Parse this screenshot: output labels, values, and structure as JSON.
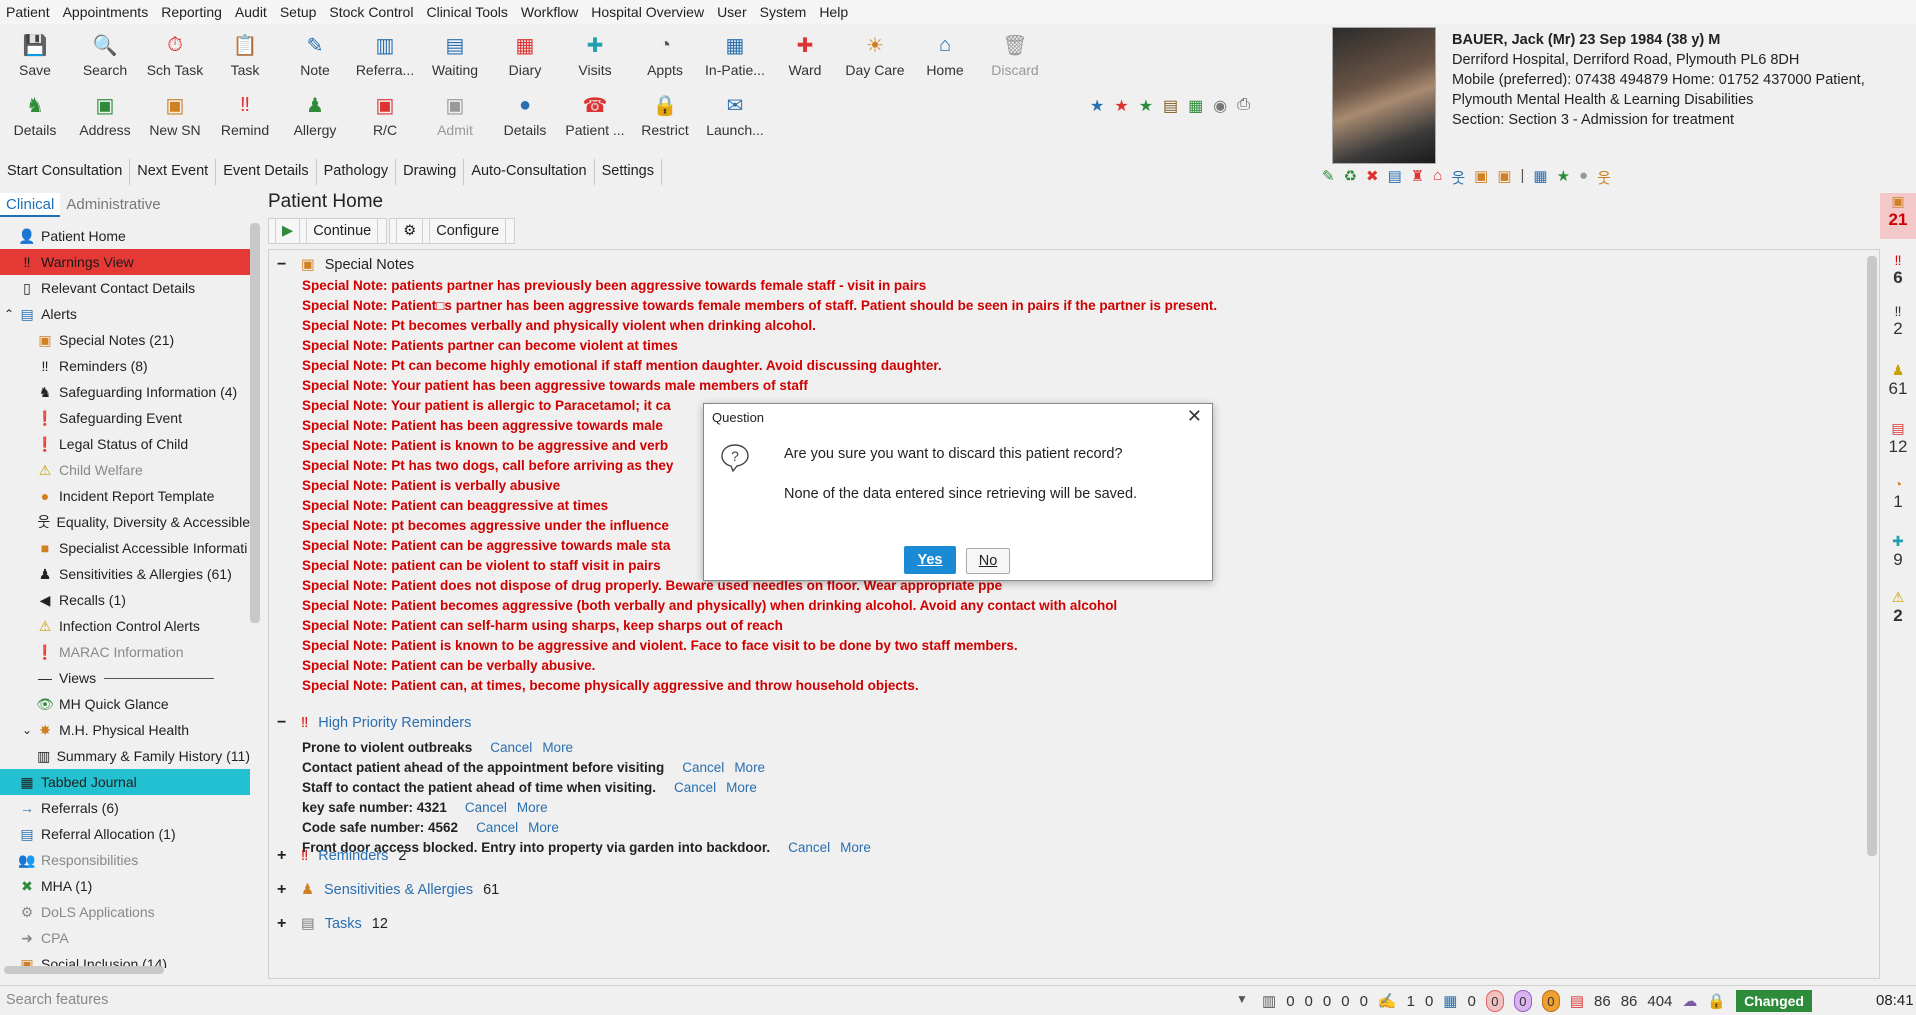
{
  "menu": [
    "Patient",
    "Appointments",
    "Reporting",
    "Audit",
    "Setup",
    "Stock Control",
    "Clinical Tools",
    "Workflow",
    "Hospital Overview",
    "User",
    "System",
    "Help"
  ],
  "toolbar": {
    "row1": [
      "Save",
      "Search",
      "Sch Task",
      "Task",
      "Note",
      "Referra...",
      "Waiting",
      "Diary",
      "Visits",
      "Appts",
      "In-Patie...",
      "Ward",
      "Day Care",
      "Home",
      "Discard"
    ],
    "row2": [
      "Details",
      "Address",
      "New SN",
      "Remind",
      "Allergy",
      "R/C",
      "Admit",
      "Details",
      "Patient ...",
      "Restrict",
      "Launch..."
    ]
  },
  "patient": {
    "name_line": "BAUER, Jack (Mr) 23 Sep 1984 (38 y) M",
    "address": "Derriford Hospital, Derriford Road, Plymouth PL6 8DH",
    "phones": "Mobile (preferred): 07438 494879 Home: 01752 437000   Patient,",
    "org": "Plymouth Mental Health & Learning Disabilities",
    "section": "Section: Section 3 - Admission for treatment"
  },
  "tabs": [
    "Start Consultation",
    "Next Event",
    "Event Details",
    "Pathology",
    "Drawing",
    "Auto-Consultation",
    "Settings"
  ],
  "left_tabs": {
    "active": "Clinical",
    "inactive": "Administrative"
  },
  "tree": [
    {
      "label": "Patient Home",
      "icon": "user-icon",
      "glyph": "👤",
      "indent": 1,
      "style": ""
    },
    {
      "label": "Warnings View",
      "icon": "warning-icon",
      "glyph": "‼",
      "indent": 1,
      "style": "sel-red"
    },
    {
      "label": "Relevant Contact Details",
      "icon": "contact-icon",
      "glyph": "▯",
      "indent": 1,
      "style": ""
    },
    {
      "label": "Alerts",
      "icon": "folder-icon",
      "glyph": "▤",
      "indent": 0,
      "style": ""
    },
    {
      "label": "Special Notes (21)",
      "icon": "note-icon",
      "glyph": "▣",
      "indent": 2,
      "style": ""
    },
    {
      "label": "Reminders (8)",
      "icon": "reminder-icon",
      "glyph": "‼",
      "indent": 2,
      "style": ""
    },
    {
      "label": "Safeguarding Information (4)",
      "icon": "safeguarding-icon",
      "glyph": "♞",
      "indent": 2,
      "style": ""
    },
    {
      "label": "Safeguarding Event",
      "icon": "alert-circle-icon",
      "glyph": "❗",
      "indent": 2,
      "style": ""
    },
    {
      "label": "Legal Status of Child",
      "icon": "alert-circle-icon",
      "glyph": "❗",
      "indent": 2,
      "style": ""
    },
    {
      "label": "Child Welfare",
      "icon": "warning-triangle-icon",
      "glyph": "⚠",
      "indent": 2,
      "style": "muted"
    },
    {
      "label": "Incident Report Template",
      "icon": "circle-icon",
      "glyph": "●",
      "indent": 2,
      "style": ""
    },
    {
      "label": "Equality, Diversity & Accessible",
      "icon": "person-icon",
      "glyph": "웃",
      "indent": 2,
      "style": ""
    },
    {
      "label": "Specialist Accessible Informati",
      "icon": "square-icon",
      "glyph": "■",
      "indent": 2,
      "style": ""
    },
    {
      "label": "Sensitivities & Allergies (61)",
      "icon": "allergy-icon",
      "glyph": "♟",
      "indent": 2,
      "style": ""
    },
    {
      "label": "Recalls (1)",
      "icon": "recall-icon",
      "glyph": "◀",
      "indent": 2,
      "style": ""
    },
    {
      "label": "Infection Control Alerts",
      "icon": "warning-triangle-icon",
      "glyph": "⚠",
      "indent": 2,
      "style": ""
    },
    {
      "label": "MARAC Information",
      "icon": "alert-circle-icon",
      "glyph": "❗",
      "indent": 2,
      "style": "muted"
    },
    {
      "label": "Views",
      "icon": "divider-icon",
      "glyph": "—",
      "indent": 2,
      "style": ""
    },
    {
      "label": "MH Quick Glance",
      "icon": "eye-icon",
      "glyph": "👁",
      "indent": 2,
      "style": ""
    },
    {
      "label": "M.H. Physical Health",
      "icon": "star-icon",
      "glyph": "✸",
      "indent": 1,
      "style": ""
    },
    {
      "label": "Summary & Family History (11)",
      "icon": "book-icon",
      "glyph": "▥",
      "indent": 2,
      "style": ""
    },
    {
      "label": "Tabbed Journal",
      "icon": "journal-icon",
      "glyph": "▦",
      "indent": 1,
      "style": "sel-cyan"
    },
    {
      "label": "Referrals (6)",
      "icon": "arrow-icon",
      "glyph": "→",
      "indent": 1,
      "style": ""
    },
    {
      "label": "Referral Allocation (1)",
      "icon": "list-icon",
      "glyph": "▤",
      "indent": 1,
      "style": ""
    },
    {
      "label": "Responsibilities",
      "icon": "people-icon",
      "glyph": "👥",
      "indent": 1,
      "style": "muted"
    },
    {
      "label": "MHA (1)",
      "icon": "cross-icon",
      "glyph": "✖",
      "indent": 1,
      "style": ""
    },
    {
      "label": "DoLS Applications",
      "icon": "dols-icon",
      "glyph": "⚙",
      "indent": 1,
      "style": "muted"
    },
    {
      "label": "CPA",
      "icon": "arrow-icon",
      "glyph": "➜",
      "indent": 1,
      "style": "muted"
    },
    {
      "label": "Social Inclusion (14)",
      "icon": "inclusion-icon",
      "glyph": "▣",
      "indent": 1,
      "style": ""
    }
  ],
  "main": {
    "title": "Patient Home",
    "continue_label": "Continue",
    "configure_label": "Configure",
    "special_notes_label": "Special Notes",
    "notes": [
      "Special Note: patients partner has previously been aggressive towards female staff - visit in pairs",
      "Special Note: Patient□s partner has been aggressive towards female members of staff. Patient should be seen in pairs if the partner is present.",
      "Special Note: Pt becomes verbally and physically violent when drinking alcohol.",
      "Special Note: Patients partner can become violent at times",
      "Special Note: Pt can become highly emotional if staff mention daughter. Avoid discussing daughter.",
      "Special Note: Your patient has been aggressive towards male members of staff",
      "Special Note: Your patient is allergic to Paracetamol; it ca",
      "Special Note: Patient has been aggressive towards male",
      "Special Note: Patient is known to be aggressive and verb",
      "Special Note: Pt has two dogs, call before arriving as they",
      "Special Note: Patient is verbally abusive",
      "Special Note: Patient can beaggressive at times",
      "Special Note: pt becomes aggressive under the influence",
      "Special Note: Patient can be aggressive towards male sta",
      "Special Note: patient can be violent to staff visit in pairs",
      "Special Note: Patient does not dispose of drug properly. Beware used needles on floor. Wear appropriate ppe",
      "Special Note: Patient becomes aggressive (both verbally and physically) when drinking alcohol. Avoid any contact with alcohol",
      "Special Note: Patient can self-harm using sharps, keep sharps out of reach",
      "Special Note: Patient is known to be aggressive and violent. Face to face visit to be done by two staff members.",
      "Special Note: Patient can be verbally abusive.",
      "Special Note: Patient can, at times, become physically aggressive and throw household objects."
    ],
    "hpr_label": "High Priority Reminders",
    "reminders": [
      {
        "text": "Prone to violent outbreaks",
        "cancel": "Cancel",
        "more": "More"
      },
      {
        "text": "Contact patient ahead of the appointment before visiting",
        "cancel": "Cancel",
        "more": "More"
      },
      {
        "text": "Staff to contact the patient ahead of time when visiting.",
        "cancel": "Cancel",
        "more": "More"
      },
      {
        "text": "key safe number: 4321",
        "cancel": "Cancel",
        "more": "More"
      },
      {
        "text": "Code safe number: 4562",
        "cancel": "Cancel",
        "more": "More"
      },
      {
        "text": "Front door access blocked. Entry into property via garden into backdoor.",
        "cancel": "Cancel",
        "more": "More"
      }
    ],
    "collapsed": [
      {
        "label": "Reminders",
        "count": "2"
      },
      {
        "label": "Sensitivities & Allergies",
        "count": "61"
      },
      {
        "label": "Tasks",
        "count": "12"
      }
    ]
  },
  "right_counters": [
    "21",
    "6",
    "2",
    "61",
    "12",
    "1",
    "9",
    "2"
  ],
  "dialog": {
    "title": "Question",
    "message": "Are you sure you want to discard this patient record?",
    "detail": "None of the data entered since retrieving will be saved.",
    "yes": "Yes",
    "no": "No"
  },
  "statusbar": {
    "search_placeholder": "Search features",
    "counts": [
      "0",
      "0",
      "0",
      "0",
      "0",
      "1",
      "0",
      "0"
    ],
    "pills": [
      "0",
      "0",
      "0"
    ],
    "nums": [
      "86",
      "86",
      "404"
    ],
    "changed": "Changed",
    "time": "08:41"
  }
}
